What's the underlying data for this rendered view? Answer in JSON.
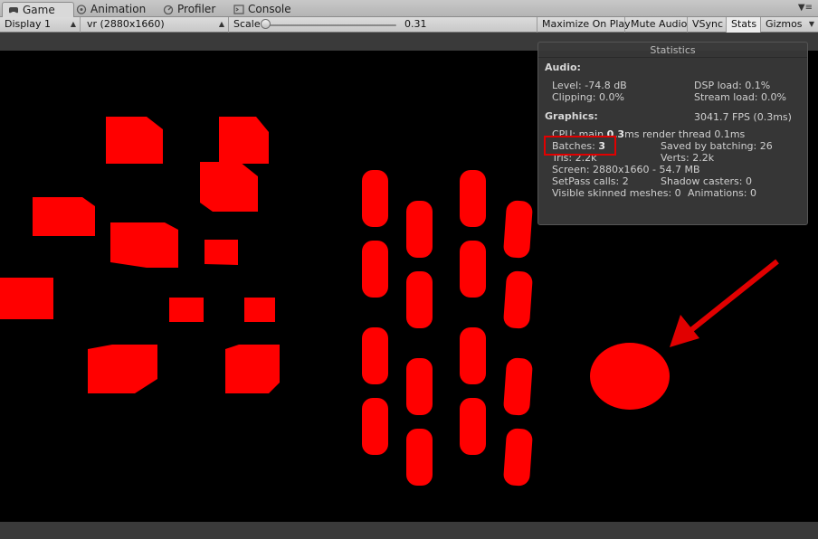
{
  "tabs": [
    {
      "label": "Game",
      "icon": "game-controller-icon",
      "active": true
    },
    {
      "label": "Animation",
      "icon": "animation-icon",
      "active": false
    },
    {
      "label": "Profiler",
      "icon": "profiler-icon",
      "active": false
    },
    {
      "label": "Console",
      "icon": "console-icon",
      "active": false
    }
  ],
  "toolbar": {
    "display": "Display 1",
    "resolution": "vr (2880x1660)",
    "scale_label": "Scale",
    "scale_value": "0.31",
    "maximize_on_play": "Maximize On Play",
    "mute_audio": "Mute Audio",
    "vsync": "VSync",
    "stats": "Stats",
    "gizmos": "Gizmos"
  },
  "stats": {
    "title": "Statistics",
    "audio_header": "Audio:",
    "level": "Level: -74.8 dB",
    "dsp_load": "DSP load: 0.1%",
    "clipping": "Clipping: 0.0%",
    "stream_load": "Stream load: 0.0%",
    "graphics_header": "Graphics:",
    "fps": "3041.7 FPS (0.3ms)",
    "cpu_prefix": "CPU: main ",
    "cpu_main": "0.3",
    "cpu_suffix": "ms   render thread 0.1ms",
    "batches_label": "Batches: ",
    "batches_value": "3",
    "saved_by_batching": "Saved by batching: 26",
    "tris": "Tris: 2.2k",
    "verts": "Verts: 2.2k",
    "screen": "Screen: 2880x1660 - 54.7 MB",
    "setpass": "SetPass calls: 2",
    "shadow_casters": "Shadow casters: 0",
    "visible_skinned": "Visible skinned meshes: 0",
    "animations": "Animations: 0"
  },
  "colors": {
    "scene_object": "#ff0000",
    "annotation": "#e10000",
    "viewport_bg": "#000000"
  }
}
